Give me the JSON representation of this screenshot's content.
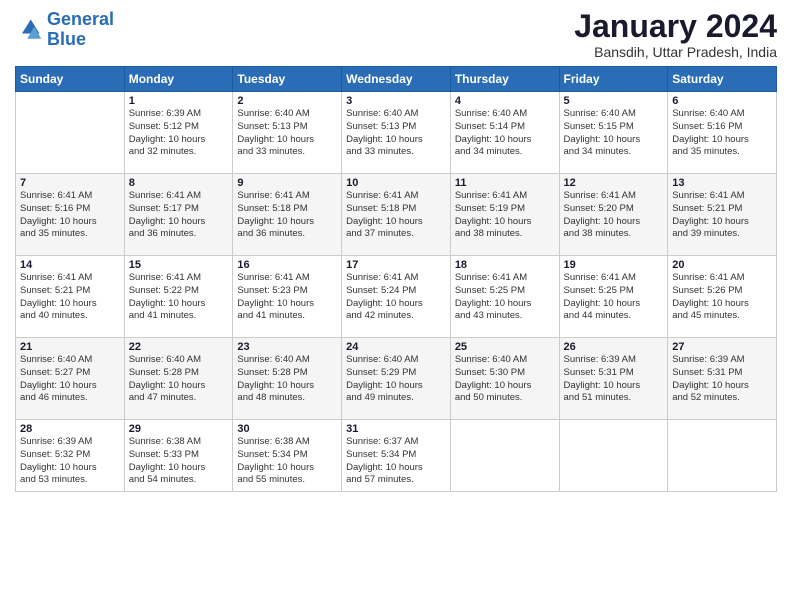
{
  "logo": {
    "line1": "General",
    "line2": "Blue"
  },
  "title": "January 2024",
  "subtitle": "Bansdih, Uttar Pradesh, India",
  "weekdays": [
    "Sunday",
    "Monday",
    "Tuesday",
    "Wednesday",
    "Thursday",
    "Friday",
    "Saturday"
  ],
  "weeks": [
    [
      {
        "day": "",
        "info": ""
      },
      {
        "day": "1",
        "info": "Sunrise: 6:39 AM\nSunset: 5:12 PM\nDaylight: 10 hours\nand 32 minutes."
      },
      {
        "day": "2",
        "info": "Sunrise: 6:40 AM\nSunset: 5:13 PM\nDaylight: 10 hours\nand 33 minutes."
      },
      {
        "day": "3",
        "info": "Sunrise: 6:40 AM\nSunset: 5:13 PM\nDaylight: 10 hours\nand 33 minutes."
      },
      {
        "day": "4",
        "info": "Sunrise: 6:40 AM\nSunset: 5:14 PM\nDaylight: 10 hours\nand 34 minutes."
      },
      {
        "day": "5",
        "info": "Sunrise: 6:40 AM\nSunset: 5:15 PM\nDaylight: 10 hours\nand 34 minutes."
      },
      {
        "day": "6",
        "info": "Sunrise: 6:40 AM\nSunset: 5:16 PM\nDaylight: 10 hours\nand 35 minutes."
      }
    ],
    [
      {
        "day": "7",
        "info": "Sunrise: 6:41 AM\nSunset: 5:16 PM\nDaylight: 10 hours\nand 35 minutes."
      },
      {
        "day": "8",
        "info": "Sunrise: 6:41 AM\nSunset: 5:17 PM\nDaylight: 10 hours\nand 36 minutes."
      },
      {
        "day": "9",
        "info": "Sunrise: 6:41 AM\nSunset: 5:18 PM\nDaylight: 10 hours\nand 36 minutes."
      },
      {
        "day": "10",
        "info": "Sunrise: 6:41 AM\nSunset: 5:18 PM\nDaylight: 10 hours\nand 37 minutes."
      },
      {
        "day": "11",
        "info": "Sunrise: 6:41 AM\nSunset: 5:19 PM\nDaylight: 10 hours\nand 38 minutes."
      },
      {
        "day": "12",
        "info": "Sunrise: 6:41 AM\nSunset: 5:20 PM\nDaylight: 10 hours\nand 38 minutes."
      },
      {
        "day": "13",
        "info": "Sunrise: 6:41 AM\nSunset: 5:21 PM\nDaylight: 10 hours\nand 39 minutes."
      }
    ],
    [
      {
        "day": "14",
        "info": "Sunrise: 6:41 AM\nSunset: 5:21 PM\nDaylight: 10 hours\nand 40 minutes."
      },
      {
        "day": "15",
        "info": "Sunrise: 6:41 AM\nSunset: 5:22 PM\nDaylight: 10 hours\nand 41 minutes."
      },
      {
        "day": "16",
        "info": "Sunrise: 6:41 AM\nSunset: 5:23 PM\nDaylight: 10 hours\nand 41 minutes."
      },
      {
        "day": "17",
        "info": "Sunrise: 6:41 AM\nSunset: 5:24 PM\nDaylight: 10 hours\nand 42 minutes."
      },
      {
        "day": "18",
        "info": "Sunrise: 6:41 AM\nSunset: 5:25 PM\nDaylight: 10 hours\nand 43 minutes."
      },
      {
        "day": "19",
        "info": "Sunrise: 6:41 AM\nSunset: 5:25 PM\nDaylight: 10 hours\nand 44 minutes."
      },
      {
        "day": "20",
        "info": "Sunrise: 6:41 AM\nSunset: 5:26 PM\nDaylight: 10 hours\nand 45 minutes."
      }
    ],
    [
      {
        "day": "21",
        "info": "Sunrise: 6:40 AM\nSunset: 5:27 PM\nDaylight: 10 hours\nand 46 minutes."
      },
      {
        "day": "22",
        "info": "Sunrise: 6:40 AM\nSunset: 5:28 PM\nDaylight: 10 hours\nand 47 minutes."
      },
      {
        "day": "23",
        "info": "Sunrise: 6:40 AM\nSunset: 5:28 PM\nDaylight: 10 hours\nand 48 minutes."
      },
      {
        "day": "24",
        "info": "Sunrise: 6:40 AM\nSunset: 5:29 PM\nDaylight: 10 hours\nand 49 minutes."
      },
      {
        "day": "25",
        "info": "Sunrise: 6:40 AM\nSunset: 5:30 PM\nDaylight: 10 hours\nand 50 minutes."
      },
      {
        "day": "26",
        "info": "Sunrise: 6:39 AM\nSunset: 5:31 PM\nDaylight: 10 hours\nand 51 minutes."
      },
      {
        "day": "27",
        "info": "Sunrise: 6:39 AM\nSunset: 5:31 PM\nDaylight: 10 hours\nand 52 minutes."
      }
    ],
    [
      {
        "day": "28",
        "info": "Sunrise: 6:39 AM\nSunset: 5:32 PM\nDaylight: 10 hours\nand 53 minutes."
      },
      {
        "day": "29",
        "info": "Sunrise: 6:38 AM\nSunset: 5:33 PM\nDaylight: 10 hours\nand 54 minutes."
      },
      {
        "day": "30",
        "info": "Sunrise: 6:38 AM\nSunset: 5:34 PM\nDaylight: 10 hours\nand 55 minutes."
      },
      {
        "day": "31",
        "info": "Sunrise: 6:37 AM\nSunset: 5:34 PM\nDaylight: 10 hours\nand 57 minutes."
      },
      {
        "day": "",
        "info": ""
      },
      {
        "day": "",
        "info": ""
      },
      {
        "day": "",
        "info": ""
      }
    ]
  ]
}
